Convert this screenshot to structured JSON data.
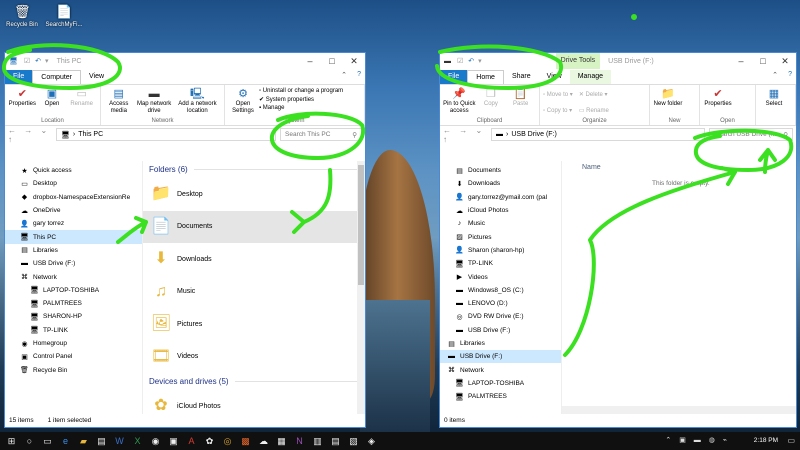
{
  "desktop": {
    "icons": [
      {
        "label": "Recycle Bin",
        "icon": "recycle-bin-icon"
      },
      {
        "label": "SearchMyFi...",
        "icon": "document-icon"
      }
    ]
  },
  "left_window": {
    "title": "This PC",
    "tabs": [
      "File",
      "Computer",
      "View"
    ],
    "ribbon": {
      "groups": [
        {
          "label": "Location",
          "buttons": [
            "Properties",
            "Open",
            "Rename"
          ]
        },
        {
          "label": "Network",
          "buttons": [
            "Access media",
            "Map network drive",
            "Add a network location"
          ]
        },
        {
          "label": "System",
          "buttons": [
            "Open Settings"
          ],
          "small": [
            "Uninstall or change a program",
            "System properties",
            "Manage"
          ]
        }
      ]
    },
    "address": "This PC",
    "search_placeholder": "Search This PC",
    "nav": [
      {
        "label": "Quick access",
        "icon": "star-icon"
      },
      {
        "label": "Desktop",
        "icon": "desktop-icon"
      },
      {
        "label": "dropbox-NamespaceExtensionRe",
        "icon": "dropbox-icon"
      },
      {
        "label": "OneDrive",
        "icon": "cloud-icon"
      },
      {
        "label": "gary torrez",
        "icon": "user-icon"
      },
      {
        "label": "This PC",
        "icon": "computer-icon"
      },
      {
        "label": "Libraries",
        "icon": "library-icon"
      },
      {
        "label": "USB Drive (F:)",
        "icon": "usb-icon"
      },
      {
        "label": "Network",
        "icon": "network-icon"
      },
      {
        "label": "LAPTOP-TOSHIBA",
        "icon": "computer-icon"
      },
      {
        "label": "PALMTREES",
        "icon": "computer-icon"
      },
      {
        "label": "SHARON-HP",
        "icon": "computer-icon"
      },
      {
        "label": "TP-LINK",
        "icon": "computer-icon"
      },
      {
        "label": "Homegroup",
        "icon": "homegroup-icon"
      },
      {
        "label": "Control Panel",
        "icon": "control-panel-icon"
      },
      {
        "label": "Recycle Bin",
        "icon": "recycle-bin-icon"
      }
    ],
    "folders_header": "Folders (6)",
    "folders": [
      {
        "label": "Desktop",
        "icon": "folder-icon"
      },
      {
        "label": "Documents",
        "icon": "documents-folder-icon"
      },
      {
        "label": "Downloads",
        "icon": "downloads-folder-icon"
      },
      {
        "label": "Music",
        "icon": "music-folder-icon"
      },
      {
        "label": "Pictures",
        "icon": "pictures-folder-icon"
      },
      {
        "label": "Videos",
        "icon": "videos-folder-icon"
      }
    ],
    "devices_header": "Devices and drives (5)",
    "devices": [
      {
        "label": "iCloud Photos",
        "icon": "icloud-photos-icon"
      }
    ],
    "status": {
      "items": "15 items",
      "selected": "1 item selected"
    }
  },
  "right_window": {
    "title": "USB Drive (F:)",
    "context_tab": "Drive Tools",
    "tabs": [
      "File",
      "Home",
      "Share",
      "View",
      "Manage"
    ],
    "ribbon": {
      "groups": [
        {
          "label": "Clipboard",
          "buttons": [
            "Pin to Quick access",
            "Copy",
            "Paste"
          ]
        },
        {
          "label": "Organize",
          "small": [
            "Move to",
            "Copy to",
            "Delete",
            "Rename"
          ]
        },
        {
          "label": "New",
          "buttons": [
            "New folder"
          ]
        },
        {
          "label": "Open",
          "buttons": [
            "Properties"
          ]
        },
        {
          "label": "",
          "buttons": [
            "Select"
          ]
        }
      ]
    },
    "address": "USB Drive (F:)",
    "search_placeholder": "Search USB Drive (...",
    "nav": [
      {
        "label": "Documents",
        "icon": "documents-icon"
      },
      {
        "label": "Downloads",
        "icon": "downloads-icon"
      },
      {
        "label": "gary.torrez@ymail.com (pal",
        "icon": "user-icon"
      },
      {
        "label": "iCloud Photos",
        "icon": "icloud-icon"
      },
      {
        "label": "Music",
        "icon": "music-icon"
      },
      {
        "label": "Pictures",
        "icon": "pictures-icon"
      },
      {
        "label": "Sharon (sharon-hp)",
        "icon": "user-icon"
      },
      {
        "label": "TP-LINK",
        "icon": "computer-icon"
      },
      {
        "label": "Videos",
        "icon": "videos-icon"
      },
      {
        "label": "Windows8_OS (C:)",
        "icon": "drive-icon"
      },
      {
        "label": "LENOVO (D:)",
        "icon": "drive-icon"
      },
      {
        "label": "DVD RW Drive (E:)",
        "icon": "dvd-icon"
      },
      {
        "label": "USB Drive (F:)",
        "icon": "usb-icon"
      },
      {
        "label": "Libraries",
        "icon": "library-icon"
      },
      {
        "label": "USB Drive (F:)",
        "icon": "usb-icon"
      },
      {
        "label": "Network",
        "icon": "network-icon"
      },
      {
        "label": "LAPTOP-TOSHIBA",
        "icon": "computer-icon"
      },
      {
        "label": "PALMTREES",
        "icon": "computer-icon"
      }
    ],
    "column": "Name",
    "empty": "This folder is empty.",
    "status": {
      "items": "0 items"
    }
  },
  "taskbar": {
    "time": "2:18 PM"
  }
}
